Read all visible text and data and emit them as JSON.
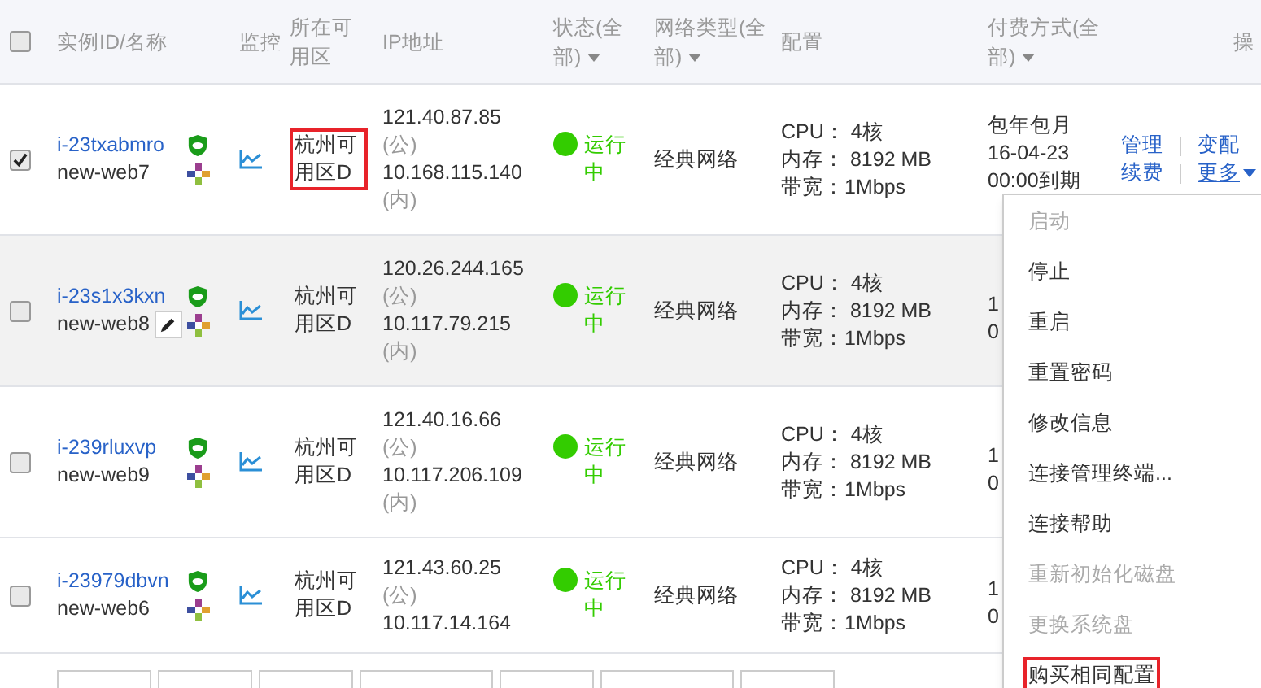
{
  "table": {
    "all_checked": false,
    "columns": [
      {
        "label": "实例ID/名称",
        "dropdown": false
      },
      {
        "label": "监控",
        "dropdown": false
      },
      {
        "label": "所在可用区",
        "dropdown": false
      },
      {
        "label": "IP地址",
        "dropdown": false
      },
      {
        "label": "状态(全部)",
        "dropdown": true
      },
      {
        "label": "网络类型(全部)",
        "dropdown": true
      },
      {
        "label": "配置",
        "dropdown": false
      },
      {
        "label": "付费方式(全部)",
        "dropdown": true
      },
      {
        "label": "操",
        "dropdown": false
      }
    ],
    "rows": [
      {
        "checked": true,
        "hovered": false,
        "editable": false,
        "id": "i-23txabmro",
        "name": "new-web7",
        "zone": "杭州可用区D",
        "zone_highlighted": true,
        "ip_public": "121.40.87.85",
        "ip_public_tag": "(公)",
        "ip_private": "10.168.115.140",
        "ip_private_tag": "(内)",
        "status": "运行中",
        "color": "#33cc00",
        "network": "经典网络",
        "config": [
          "CPU： 4核",
          "内存： 8192 MB",
          "带宽：1Mbps"
        ],
        "payment": [
          "包年包月",
          "16-04-23",
          "00:00到期"
        ],
        "actions": [
          "管理",
          "变配",
          "续费",
          "更多"
        ]
      },
      {
        "checked": false,
        "hovered": true,
        "editable": true,
        "id": "i-23s1x3kxn",
        "name": "new-web8",
        "zone": "杭州可用区D",
        "zone_highlighted": false,
        "ip_public": "120.26.244.165",
        "ip_public_tag": "(公)",
        "ip_private": "10.117.79.215",
        "ip_private_tag": "(内)",
        "status": "运行中",
        "color": "#33cc00",
        "network": "经典网络",
        "config": [
          "CPU： 4核",
          "内存： 8192 MB",
          "带宽：1Mbps"
        ],
        "payment": [
          "1",
          "0"
        ]
      },
      {
        "checked": false,
        "hovered": false,
        "editable": false,
        "id": "i-239rluxvp",
        "name": "new-web9",
        "zone": "杭州可用区D",
        "zone_highlighted": false,
        "ip_public": "121.40.16.66",
        "ip_public_tag": "(公)",
        "ip_private": "10.117.206.109",
        "ip_private_tag": "(内)",
        "status": "运行中",
        "color": "#33cc00",
        "network": "经典网络",
        "config": [
          "CPU： 4核",
          "内存： 8192 MB",
          "带宽：1Mbps"
        ],
        "payment": [
          "1",
          "0"
        ]
      },
      {
        "checked": false,
        "hovered": false,
        "editable": false,
        "id": "i-23979dbvn",
        "name": "new-web6",
        "zone": "杭州可用区D",
        "zone_highlighted": false,
        "ip_public": "121.43.60.25",
        "ip_public_tag": "(公)",
        "ip_private": "10.117.14.164",
        "status": "运行中",
        "color": "#33cc00",
        "network": "经典网络",
        "config": [
          "CPU： 4核",
          "内存： 8192 MB",
          "带宽：1Mbps"
        ],
        "payment": [
          "1",
          "0"
        ]
      }
    ]
  },
  "menu": {
    "items": [
      {
        "label": "启动",
        "disabled": true,
        "highlighted": false
      },
      {
        "label": "停止",
        "disabled": false,
        "highlighted": false
      },
      {
        "label": "重启",
        "disabled": false,
        "highlighted": false
      },
      {
        "label": "重置密码",
        "disabled": false,
        "highlighted": false
      },
      {
        "label": "修改信息",
        "disabled": false,
        "highlighted": false
      },
      {
        "label": "连接管理终端...",
        "disabled": false,
        "highlighted": false
      },
      {
        "label": "连接帮助",
        "disabled": false,
        "highlighted": false
      },
      {
        "label": "重新初始化磁盘",
        "disabled": true,
        "highlighted": false
      },
      {
        "label": "更换系统盘",
        "disabled": true,
        "highlighted": false
      },
      {
        "label": "购买相同配置",
        "disabled": false,
        "highlighted": true
      }
    ]
  },
  "footer": {
    "buttons": [
      {
        "wide": false
      },
      {
        "wide": false
      },
      {
        "wide": false
      },
      {
        "wide": true
      },
      {
        "wide": false
      },
      {
        "wide": true
      },
      {
        "wide": false
      }
    ]
  }
}
